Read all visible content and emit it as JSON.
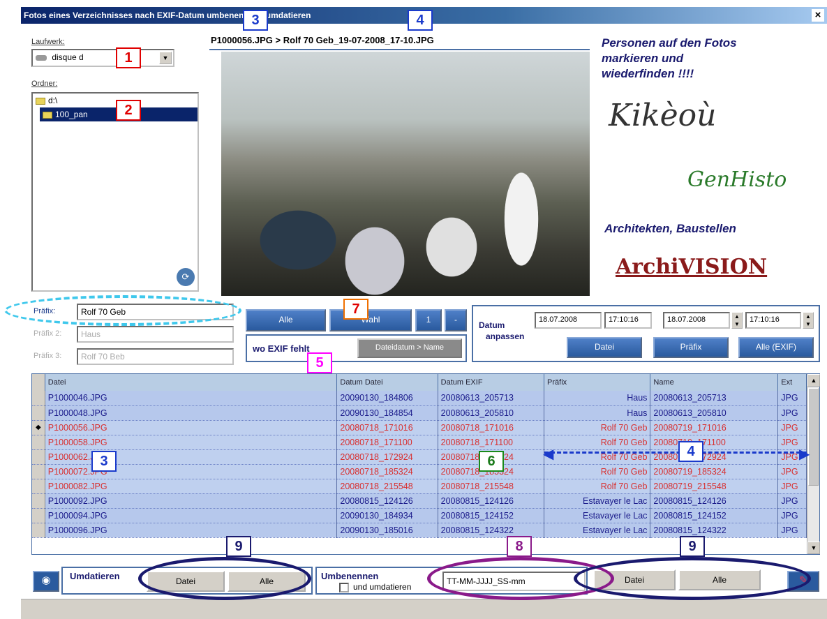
{
  "window": {
    "title": "Fotos eines Verzeichnisses nach EXIF-Datum umbenennen / umdatieren",
    "close": "×"
  },
  "drive": {
    "label": "Laufwerk:",
    "value": "disque d"
  },
  "folder": {
    "label": "Ordner:",
    "items": [
      "d:\\",
      "100_pan"
    ]
  },
  "photo": {
    "caption": "P1000056.JPG > Rolf 70 Geb_19-07-2008_17-10.JPG"
  },
  "ads": {
    "line1": "Personen auf den Fotos",
    "line2": "markieren und",
    "line3": "wiederfinden !!!!",
    "kikeou": "Kikèoù",
    "genhisto": "GenHisto",
    "architekten": "Architekten, Baustellen",
    "archivision": "ArchiVISION"
  },
  "prefix": {
    "label1": "Präfix:",
    "value1": "Rolf 70 Geb",
    "label2": "Präfix 2:",
    "value2": "Haus",
    "label3": "Präfix 3:",
    "value3": "Rolf 70 Beb"
  },
  "select_buttons": {
    "all": "Alle",
    "selection": "Wahl",
    "one": "1",
    "minus": "-"
  },
  "exif_section": {
    "label": "wo EXIF fehlt",
    "button": "Dateidatum > Name"
  },
  "date_adjust": {
    "label1": "Datum",
    "label2": "anpassen",
    "date1": "18.07.2008",
    "time1": "17:10:16",
    "date2": "18.07.2008",
    "time2": "17:10:16",
    "btn_file": "Datei",
    "btn_prefix": "Präfix",
    "btn_all": "Alle (EXIF)"
  },
  "table": {
    "columns": [
      "Datei",
      "Datum Datei",
      "Datum EXIF",
      "Präfix",
      "Name",
      "Ext"
    ],
    "rows": [
      {
        "file": "P1000046.JPG",
        "date_file": "20090130_184806",
        "date_exif": "20080613_205713",
        "prefix": "Haus",
        "name": "20080613_205713",
        "ext": "JPG",
        "style": "blue"
      },
      {
        "file": "P1000048.JPG",
        "date_file": "20090130_184854",
        "date_exif": "20080613_205810",
        "prefix": "Haus",
        "name": "20080613_205810",
        "ext": "JPG",
        "style": "blue"
      },
      {
        "file": "P1000056.JPG",
        "date_file": "20080718_171016",
        "date_exif": "20080718_171016",
        "prefix": "Rolf 70 Geb",
        "name": "20080719_171016",
        "ext": "JPG",
        "style": "red",
        "current": true
      },
      {
        "file": "P1000058.JPG",
        "date_file": "20080718_171100",
        "date_exif": "20080718_171100",
        "prefix": "Rolf 70 Geb",
        "name": "20080719_171100",
        "ext": "JPG",
        "style": "red"
      },
      {
        "file": "P1000062.JPG",
        "date_file": "20080718_172924",
        "date_exif": "20080718_172924",
        "prefix": "Rolf 70 Geb",
        "name": "20080719_172924",
        "ext": "JPG",
        "style": "red"
      },
      {
        "file": "P1000072.JPG",
        "date_file": "20080718_185324",
        "date_exif": "20080718_185324",
        "prefix": "Rolf 70 Geb",
        "name": "20080719_185324",
        "ext": "JPG",
        "style": "red"
      },
      {
        "file": "P1000082.JPG",
        "date_file": "20080718_215548",
        "date_exif": "20080718_215548",
        "prefix": "Rolf 70 Geb",
        "name": "20080719_215548",
        "ext": "JPG",
        "style": "red"
      },
      {
        "file": "P1000092.JPG",
        "date_file": "20080815_124126",
        "date_exif": "20080815_124126",
        "prefix": "Estavayer le Lac",
        "name": "20080815_124126",
        "ext": "JPG",
        "style": "blue"
      },
      {
        "file": "P1000094.JPG",
        "date_file": "20090130_184934",
        "date_exif": "20080815_124152",
        "prefix": "Estavayer le Lac",
        "name": "20080815_124152",
        "ext": "JPG",
        "style": "blue"
      },
      {
        "file": "P1000096.JPG",
        "date_file": "20090130_185016",
        "date_exif": "20080815_124322",
        "prefix": "Estavayer le Lac",
        "name": "20080815_124322",
        "ext": "JPG",
        "style": "blue"
      }
    ]
  },
  "bottom": {
    "umdatieren": "Umdatieren",
    "btn_file": "Datei",
    "btn_all": "Alle",
    "umbenennen": "Umbenennen",
    "und_umdatieren": "und umdatieren",
    "format": "TT-MM-JJJJ_SS-mm",
    "btn_file2": "Datei",
    "btn_all2": "Alle"
  },
  "markers": {
    "m1": "1",
    "m2": "2",
    "m3a": "3",
    "m4a": "4",
    "m7": "7",
    "m5": "5",
    "m4b": "4",
    "m3b": "3",
    "m6": "6",
    "m9a": "9",
    "m8": "8",
    "m9b": "9"
  },
  "colors": {
    "title_bar": "#0a246a",
    "selected_red": "#d83030",
    "grid_blue": "#b6c8ec"
  }
}
